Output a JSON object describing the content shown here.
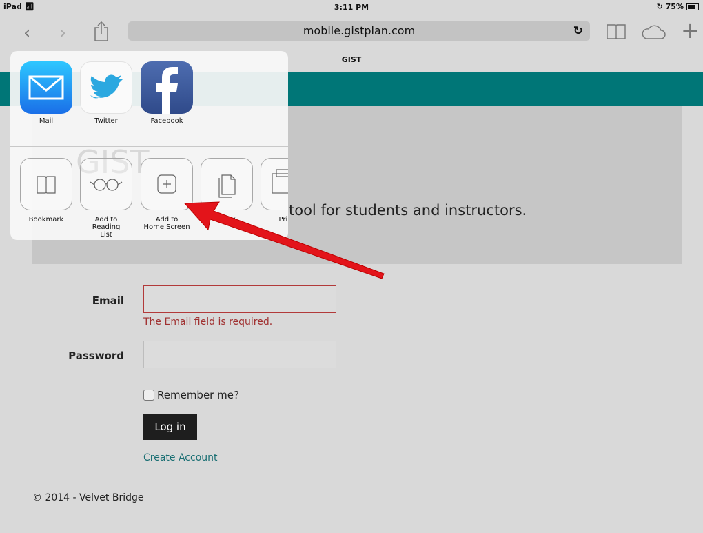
{
  "status": {
    "device": "iPad",
    "time": "3:11 PM",
    "battery": "75%"
  },
  "browser": {
    "url": "mobile.gistplan.com",
    "tab_title": "GIST"
  },
  "share_sheet": {
    "apps": [
      {
        "label": "Mail",
        "icon": "mail-icon"
      },
      {
        "label": "Twitter",
        "icon": "twitter-icon"
      },
      {
        "label": "Facebook",
        "icon": "facebook-icon"
      }
    ],
    "actions": [
      {
        "label": "Bookmark",
        "icon": "book-icon"
      },
      {
        "label": "Add to Reading\nList",
        "icon": "glasses-icon"
      },
      {
        "label": "Add to\nHome Screen",
        "icon": "plus-icon"
      },
      {
        "label": "Copy",
        "icon": "copy-icon"
      },
      {
        "label": "Print",
        "icon": "print-icon"
      }
    ]
  },
  "page": {
    "hero_tagline": "tool for students and instructors.",
    "hero_ghost_title": "GIST",
    "email_label": "Email",
    "email_error": "The Email field is required.",
    "password_label": "Password",
    "remember_label": "Remember me?",
    "login_label": "Log in",
    "create_account_label": "Create Account",
    "footer": "© 2014 - Velvet Bridge"
  },
  "colors": {
    "header_teal": "#007677",
    "error_red": "#b23a3a",
    "link_teal": "#1a6f73",
    "arrow_red": "#e3141a"
  }
}
